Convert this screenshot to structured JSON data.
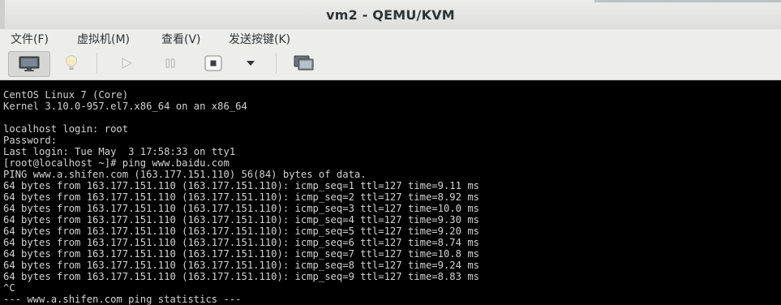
{
  "window": {
    "title": "vm2 - QEMU/KVM"
  },
  "menu": [
    {
      "label": "文件(F)"
    },
    {
      "label": "虚拟机(M)"
    },
    {
      "label": "查看(V)"
    },
    {
      "label": "发送按键(K)"
    }
  ],
  "toolbar": {
    "buttons": [
      {
        "icon": "monitor-icon",
        "label": "show graphical console",
        "active": true
      },
      {
        "icon": "lightbulb-icon",
        "label": "show virtual hardware details",
        "active": false
      },
      {
        "icon": "play-icon",
        "label": "run",
        "active": false
      },
      {
        "icon": "pause-icon",
        "label": "pause",
        "active": false
      },
      {
        "icon": "power-icon",
        "label": "shut down",
        "active": false
      },
      {
        "icon": "dropdown-arrow-icon",
        "label": "shutdown options",
        "active": false
      },
      {
        "icon": "fullscreen-icon",
        "label": "fullscreen",
        "active": false
      }
    ]
  },
  "console": {
    "lines": [
      "CentOS Linux 7 (Core)",
      "Kernel 3.10.0-957.el7.x86_64 on an x86_64",
      "",
      "localhost login: root",
      "Password:",
      "Last login: Tue May  3 17:58:33 on tty1",
      "[root@localhost ~]# ping www.baidu.com",
      "PING www.a.shifen.com (163.177.151.110) 56(84) bytes of data.",
      "64 bytes from 163.177.151.110 (163.177.151.110): icmp_seq=1 ttl=127 time=9.11 ms",
      "64 bytes from 163.177.151.110 (163.177.151.110): icmp_seq=2 ttl=127 time=8.92 ms",
      "64 bytes from 163.177.151.110 (163.177.151.110): icmp_seq=3 ttl=127 time=10.0 ms",
      "64 bytes from 163.177.151.110 (163.177.151.110): icmp_seq=4 ttl=127 time=9.30 ms",
      "64 bytes from 163.177.151.110 (163.177.151.110): icmp_seq=5 ttl=127 time=9.20 ms",
      "64 bytes from 163.177.151.110 (163.177.151.110): icmp_seq=6 ttl=127 time=8.74 ms",
      "64 bytes from 163.177.151.110 (163.177.151.110): icmp_seq=7 ttl=127 time=10.8 ms",
      "64 bytes from 163.177.151.110 (163.177.151.110): icmp_seq=8 ttl=127 time=9.24 ms",
      "64 bytes from 163.177.151.110 (163.177.151.110): icmp_seq=9 ttl=127 time=8.83 ms",
      "^C",
      "--- www.a.shifen.com ping statistics ---"
    ]
  },
  "colors": {
    "console_bg": "#000000",
    "console_fg": "#d3d3d3",
    "chrome_bg": "#ededec",
    "title_fg": "#2e3436"
  }
}
